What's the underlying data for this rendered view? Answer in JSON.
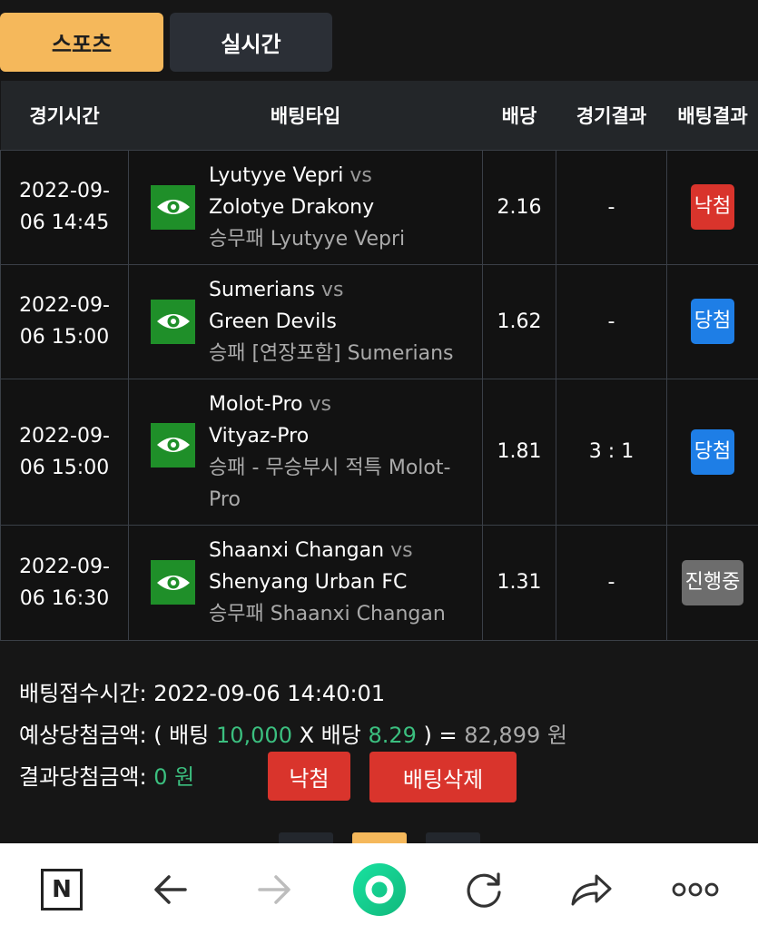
{
  "tabs": {
    "sports": "스포츠",
    "live": "실시간"
  },
  "table": {
    "headers": {
      "time": "경기시간",
      "bet_type": "배팅타입",
      "odds": "배당",
      "game_result": "경기결과",
      "bet_result": "배팅결과"
    },
    "vs": "vs",
    "rows": [
      {
        "date": "2022-09-",
        "time": "06 14:45",
        "home": "Lyutyye Vepri",
        "away": "Zolotye Drakony",
        "market_line1": "승무패 Lyutyye Vepri",
        "market_line2": "",
        "odds": "2.16",
        "game_result": "-",
        "bet_result": "낙첨",
        "status": "lose"
      },
      {
        "date": "2022-09-",
        "time": "06 15:00",
        "home": "Sumerians",
        "away": "Green Devils",
        "market_line1": "승패 [연장포함] Sumerians",
        "market_line2": "",
        "odds": "1.62",
        "game_result": "-",
        "bet_result": "당첨",
        "status": "win"
      },
      {
        "date": "2022-09-",
        "time": "06 15:00",
        "home": "Molot-Pro",
        "away": "Vityaz-Pro",
        "market_line1": "승패 - 무승부시 적특 Molot-",
        "market_line2": "Pro",
        "odds": "1.81",
        "game_result": "3 : 1",
        "bet_result": "당첨",
        "status": "win"
      },
      {
        "date": "2022-09-",
        "time": "06 16:30",
        "home": "Shaanxi Changan",
        "away": "Shenyang Urban FC",
        "market_line1": "승무패 Shaanxi Changan",
        "market_line2": "",
        "odds": "1.31",
        "game_result": "-",
        "bet_result": "진행중",
        "status": "pending"
      }
    ]
  },
  "summary": {
    "received_label": "배팅접수시간: ",
    "received_value": "2022-09-06 14:40:01",
    "expected_label": "예상당첨금액: ( 배팅 ",
    "stake": "10,000",
    "x_label": " X 배당 ",
    "total_odds": "8.29",
    "eq_label": " ) = ",
    "expected_value": "82,899 원",
    "result_label": "결과당첨금액: ",
    "result_value": "0 원",
    "result_badge": "낙첨",
    "delete_button": "배팅삭제"
  },
  "colors": {
    "accent": "#f5b85b",
    "lose": "#d9342c",
    "win": "#1e7ee6",
    "pending": "#6d6d6d",
    "green": "#3bbf7f",
    "eye_bg": "#1f8f29"
  },
  "navbar": {
    "icons": [
      "naver-n-icon",
      "back-arrow-icon",
      "forward-arrow-icon",
      "green-circle-home-icon",
      "refresh-icon",
      "share-icon",
      "more-dots-icon"
    ],
    "n_label": "N"
  }
}
